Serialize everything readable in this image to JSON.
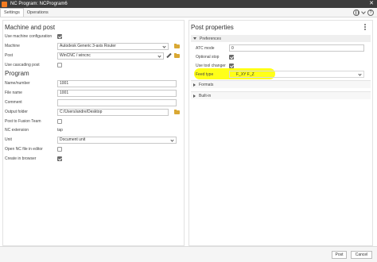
{
  "window": {
    "title": "NC Program: NCProgram6",
    "close_glyph": "✕"
  },
  "tabs": [
    {
      "label": "Settings",
      "active": true
    },
    {
      "label": "Operations",
      "active": false
    }
  ],
  "left": {
    "machine_section": {
      "heading": "Machine and post",
      "use_machine_config_label": "Use machine configuration",
      "use_machine_config_checked": true,
      "machine_label": "Machine",
      "machine_value": "Autodesk Generic 3-axis Router",
      "post_label": "Post",
      "post_value": "WinCNC / wincnc",
      "use_cascading_post_label": "Use cascading post",
      "use_cascading_post_checked": false
    },
    "program_section": {
      "heading": "Program",
      "name_number_label": "Name/number",
      "name_number_value": "1001",
      "file_name_label": "File name",
      "file_name_value": "1001",
      "comment_label": "Comment",
      "comment_value": "",
      "output_folder_label": "Output folder",
      "output_folder_value": "C:/Users/andre/Desktop",
      "post_fusion_team_label": "Post to Fusion Team",
      "post_fusion_team_checked": false,
      "nc_extension_label": "NC extension",
      "nc_extension_value": "tap",
      "unit_label": "Unit",
      "unit_value": "Document unit",
      "open_nc_editor_label": "Open NC file in editor",
      "open_nc_editor_checked": false,
      "create_browser_label": "Create in browser",
      "create_browser_checked": true
    }
  },
  "right": {
    "heading": "Post properties",
    "preferences_group": "Preferences",
    "atc_mode_label": "ATC mode",
    "atc_mode_value": "0",
    "optional_stop_label": "Optional stop",
    "optional_stop_checked": true,
    "use_tool_changer_label": "Use tool changer",
    "use_tool_changer_checked": true,
    "feed_type_label": "Feed type",
    "feed_type_value": "F_XY F_Z",
    "highlight_color": "#ffff00",
    "formats_group": "Formats",
    "builtin_group": "Built-in"
  },
  "footer": {
    "post_label": "Post",
    "cancel_label": "Cancel"
  }
}
